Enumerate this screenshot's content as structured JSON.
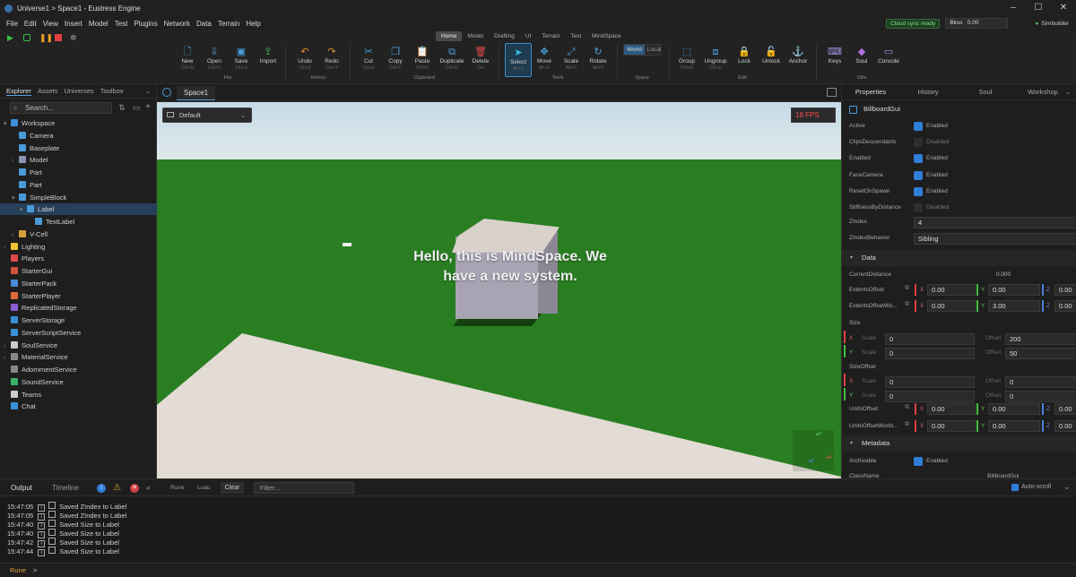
{
  "title": {
    "text": "Universe1 > Space1 - Eustress Engine"
  },
  "menu": [
    "File",
    "Edit",
    "View",
    "Insert",
    "Model",
    "Test",
    "Plugins",
    "Network",
    "Data",
    "Terrain",
    "Help"
  ],
  "status": {
    "cloud": "Cloud sync ready",
    "field_label": "Bkss",
    "field_value": "0.00",
    "user": "Simbuilder"
  },
  "ribbon_tabs": [
    "Home",
    "Model",
    "Drafting",
    "UI",
    "Terrain",
    "Test",
    "MindSpace"
  ],
  "ribbon": {
    "new": "New",
    "new_sc": "Ctrl+N",
    "open": "Open",
    "open_sc": "Ctrl+O",
    "save": "Save",
    "save_sc": "Ctrl+S",
    "import": "Import",
    "file": "File",
    "undo": "Undo",
    "undo_sc": "Ctrl+Z",
    "redo": "Redo",
    "redo_sc": "Ctrl+Y",
    "history": "History",
    "cut": "Cut",
    "cut_sc": "Ctrl+X",
    "copy": "Copy",
    "copy_sc": "Ctrl+C",
    "paste": "Paste",
    "paste_sc": "Ctrl+V",
    "duplicate": "Duplicate",
    "duplicate_sc": "Ctrl+D",
    "delete": "Delete",
    "delete_sc": "Del",
    "clipboard": "Clipboard",
    "select": "Select",
    "select_sc": "Alt+Z",
    "move": "Move",
    "move_sc": "Alt+X",
    "scale": "Scale",
    "scale_sc": "Alt+C",
    "rotate": "Rotate",
    "rotate_sc": "Alt+V",
    "tools": "Tools",
    "world": "World",
    "local": "Local",
    "space": "Space",
    "group": "Group",
    "group_sc": "Ctrl+G",
    "ungroup": "Ungroup",
    "ungroup_sc": "Ctrl+U",
    "lock": "Lock",
    "unlock": "Unlock",
    "anchor": "Anchor",
    "edit": "Edit",
    "keys": "Keys",
    "soul": "Soul",
    "console": "Console",
    "utils": "Utils"
  },
  "explorer": {
    "tabs": [
      "Explorer",
      "Assets",
      "Universes",
      "Toolbox"
    ],
    "search": "Search...",
    "items": [
      {
        "label": "Workspace",
        "color": "#3a8fd8"
      },
      {
        "label": "Camera",
        "color": "#4a9ad8"
      },
      {
        "label": "Baseplate",
        "color": "#4a9ad8"
      },
      {
        "label": "Model",
        "color": "#8a96b0"
      },
      {
        "label": "Part",
        "color": "#4a9ad8"
      },
      {
        "label": "Part",
        "color": "#4a9ad8"
      },
      {
        "label": "SimpleBlock",
        "color": "#4a9ad8"
      },
      {
        "label": "Label",
        "color": "#4a9ad8"
      },
      {
        "label": "TextLabel",
        "color": "#4a9ad8"
      },
      {
        "label": "V-Cell",
        "color": "#d8a03a"
      },
      {
        "label": "Lighting",
        "color": "#f0c030"
      },
      {
        "label": "Players",
        "color": "#e04a4a"
      },
      {
        "label": "StarterGui",
        "color": "#d0503a"
      },
      {
        "label": "StarterPack",
        "color": "#4a8ad8"
      },
      {
        "label": "StarterPlayer",
        "color": "#e06a3a"
      },
      {
        "label": "ReplicatedStorage",
        "color": "#8a60d0"
      },
      {
        "label": "ServerStorage",
        "color": "#3a8fd8"
      },
      {
        "label": "ServerScriptService",
        "color": "#3a8fd8"
      },
      {
        "label": "SoulService",
        "color": "#cccccc"
      },
      {
        "label": "MaterialService",
        "color": "#888888"
      },
      {
        "label": "AdornmentService",
        "color": "#888888"
      },
      {
        "label": "SoundService",
        "color": "#3ab06a"
      },
      {
        "label": "Teams",
        "color": "#cccccc"
      },
      {
        "label": "Chat",
        "color": "#3a8fd8"
      }
    ]
  },
  "viewport": {
    "tab": "Space1",
    "camera": "Default",
    "fps": "18 FPS",
    "hello_line1": "Hello, this is MindSpace. We",
    "hello_line2": "have a new system."
  },
  "props": {
    "tabs": [
      "Properties",
      "History",
      "Soul",
      "Workshop"
    ],
    "object": "BillboardGui",
    "rows": [
      {
        "name": "Active",
        "value": "Enabled",
        "on": true
      },
      {
        "name": "ClipsDescendants",
        "value": "Disabled",
        "on": false
      },
      {
        "name": "Enabled",
        "value": "Enabled",
        "on": true
      },
      {
        "name": "FaceCamera",
        "value": "Enabled",
        "on": true
      },
      {
        "name": "ResetOnSpawn",
        "value": "Enabled",
        "on": true
      },
      {
        "name": "StiffnessByDistance",
        "value": "Disabled",
        "on": false
      }
    ],
    "zindex_label": "ZIndex",
    "zindex": "4",
    "zbehavior_label": "ZIndexBehavior",
    "zbehavior": "Sibling",
    "data_section": "Data",
    "curdist_label": "CurrentDistance",
    "curdist": "0.000",
    "extents_label": "ExtentsOffset",
    "ext_x": "0.00",
    "ext_y": "0.00",
    "ext_z": "0.00",
    "extworld_label": "ExtentsOffsetWo...",
    "extw_x": "0.00",
    "extw_y": "3.00",
    "extw_z": "0.00",
    "size_label": "Size",
    "size_xs": "0",
    "size_xo": "200",
    "size_ys": "0",
    "size_yo": "50",
    "sizeoff_label": "SizeOffset",
    "so_xs": "0",
    "so_xo": "0",
    "so_ys": "0",
    "so_yo": "0",
    "scale": "Scale",
    "offset": "Offset",
    "x": "X",
    "y": "Y",
    "z": "Z",
    "units_label": "UnitsOffset",
    "u_x": "0.00",
    "u_y": "0.00",
    "u_z": "0.00",
    "unitsw_label": "UnitsOffsetWorld...",
    "uw_x": "0.00",
    "uw_y": "0.00",
    "uw_z": "0.00",
    "meta_section": "Metadata",
    "archivable_label": "Archivable",
    "archivable": "Enabled",
    "classname_label": "ClassName",
    "classname": "BillboardGui"
  },
  "output": {
    "tabs": [
      "Output",
      "Timeline"
    ],
    "rune": "Rune",
    "luau": "Luau",
    "clear": "Clear",
    "filter": "Filter...",
    "autoscroll": "Auto-scroll",
    "lines": [
      {
        "time": "15:47:05",
        "msg": "Saved ZIndex to Label"
      },
      {
        "time": "15:47:05",
        "msg": "Saved ZIndex to Label"
      },
      {
        "time": "15:47:40",
        "msg": "Saved Size to Label"
      },
      {
        "time": "15:47:40",
        "msg": "Saved Size to Label"
      },
      {
        "time": "15:47:42",
        "msg": "Saved Size to Label"
      },
      {
        "time": "15:47:44",
        "msg": "Saved Size to Label"
      }
    ],
    "cmd_lang": "Rune",
    "prompt": ">"
  }
}
